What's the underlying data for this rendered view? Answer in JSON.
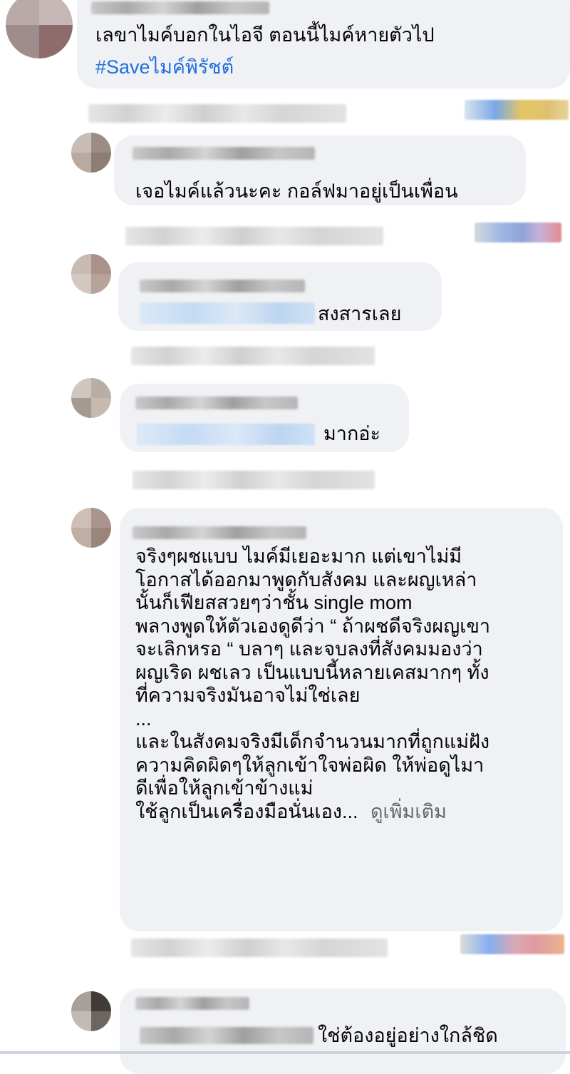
{
  "comments": [
    {
      "id": "c1",
      "lines": [
        "เลขาไมค์บอกในไอจี ตอนนี้ไมค์หายตัวไป"
      ],
      "hashtag": "#Saveไมค์พิรัชต์"
    },
    {
      "id": "c2",
      "lines": [
        "เจอไมค์แล้วนะคะ กอล์ฟมาอยู่เป็นเพื่อน"
      ]
    },
    {
      "id": "c3",
      "lines": [
        "สงสารเลย"
      ]
    },
    {
      "id": "c4",
      "lines": [
        "มากอ่ะ"
      ]
    },
    {
      "id": "c5",
      "lines": [
        "จริงๆผชแบบ ไมค์มีเยอะมาก แต่เขาไม่มี",
        "โอกาสได้ออกมาพูดกับสังคม และผญเหล่า",
        "นั้นก็เฟียสสวยๆว่าชั้น single mom",
        "พลางพูดให้ตัวเองดูดีว่า “ ถ้าผชดีจริงผญเขา",
        "จะเลิกหรอ “ บลาๆ และจบลงที่สังคมมองว่า",
        "ผญเริด ผชเลว เป็นแบบนี้หลายเคสมากๆ ทั้ง",
        "ที่ความจริงมันอาจไม่ใช่เลย",
        "...",
        "และในสังคมจริงมีเด็กจำนวนมากที่ถูกแม่ฝัง",
        "ความคิดผิดๆให้ลูกเข้าใจพ่อผิด ให้พ่อดูไมา",
        "ดีเพื่อให้ลูกเข้าข้างแม่"
      ],
      "last_line": "ใช้ลูกเป็นเครื่องมือนั่นเอง...",
      "see_more": "ดูเพิ่มเติม"
    },
    {
      "id": "c6",
      "lines": [
        "ใช่ต้องอยู่อย่างใกล้ชิด"
      ]
    }
  ],
  "colors": {
    "bubble": "#eff1f4",
    "link": "#216fdb",
    "muted": "#65676b",
    "text": "#050505"
  }
}
